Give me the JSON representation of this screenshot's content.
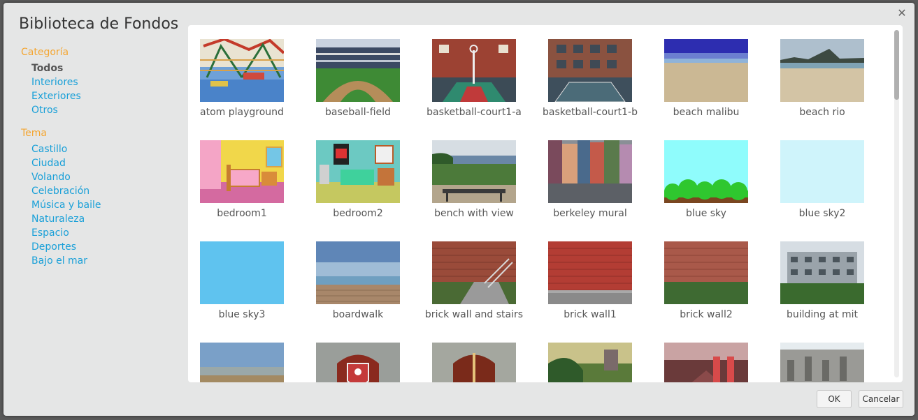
{
  "dialog": {
    "title": "Biblioteca de Fondos",
    "ok_label": "OK",
    "cancel_label": "Cancelar"
  },
  "sidebar": {
    "categoria_title": "Categoría",
    "categoria": [
      "Todos",
      "Interiores",
      "Exteriores",
      "Otros"
    ],
    "categoria_active": "Todos",
    "tema_title": "Tema",
    "tema": [
      "Castillo",
      "Ciudad",
      "Volando",
      "Celebración",
      "Música y baile",
      "Naturaleza",
      "Espacio",
      "Deportes",
      "Bajo el mar"
    ]
  },
  "backdrops": [
    {
      "label": "atom playground",
      "thumb": "playground"
    },
    {
      "label": "baseball-field",
      "thumb": "stadium"
    },
    {
      "label": "basketball-court1-a",
      "thumb": "court-a"
    },
    {
      "label": "basketball-court1-b",
      "thumb": "court-b"
    },
    {
      "label": "beach malibu",
      "thumb": "beach-malibu"
    },
    {
      "label": "beach rio",
      "thumb": "beach-rio"
    },
    {
      "label": "bedroom1",
      "thumb": "bedroom1"
    },
    {
      "label": "bedroom2",
      "thumb": "bedroom2"
    },
    {
      "label": "bench with view",
      "thumb": "bench"
    },
    {
      "label": "berkeley mural",
      "thumb": "mural"
    },
    {
      "label": "blue sky",
      "thumb": "bluesky-bushes"
    },
    {
      "label": "blue sky2",
      "thumb": "bluesky2"
    },
    {
      "label": "blue sky3",
      "thumb": "bluesky3"
    },
    {
      "label": "boardwalk",
      "thumb": "boardwalk"
    },
    {
      "label": "brick wall and stairs",
      "thumb": "brick-stairs"
    },
    {
      "label": "brick wall1",
      "thumb": "brick1"
    },
    {
      "label": "brick wall2",
      "thumb": "brick2"
    },
    {
      "label": "building at mit",
      "thumb": "mit"
    },
    {
      "label": "",
      "thumb": "coast"
    },
    {
      "label": "",
      "thumb": "castle-door-shield"
    },
    {
      "label": "",
      "thumb": "castle-door"
    },
    {
      "label": "",
      "thumb": "forest-castle"
    },
    {
      "label": "",
      "thumb": "red-hall"
    },
    {
      "label": "",
      "thumb": "ruins"
    }
  ]
}
